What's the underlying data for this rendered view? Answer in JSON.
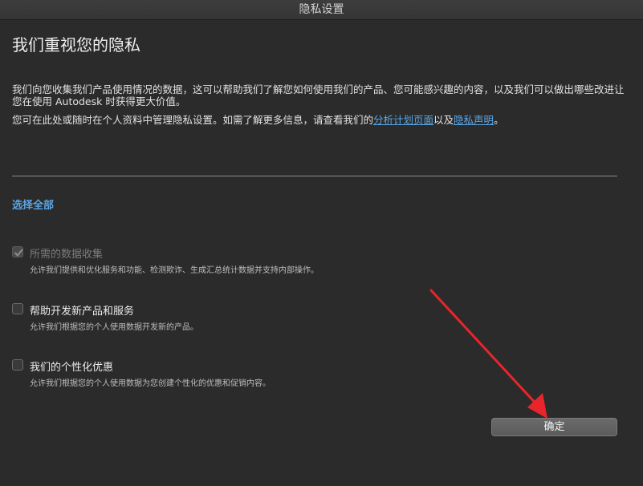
{
  "window": {
    "title": "隐私设置"
  },
  "page": {
    "title": "我们重视您的隐私"
  },
  "intro": {
    "paragraph1": "我们向您收集我们产品使用情况的数据，这可以帮助我们了解您如何使用我们的产品、您可能感兴趣的内容，以及我们可以做出哪些改进让您在使用 Autodesk 时获得更大价值。",
    "p2_before": "您可在此处或随时在个人资料中管理隐私设置。如需了解更多信息，请查看我们的",
    "p2_link1": "分析计划页面",
    "p2_middle": "以及",
    "p2_link2": "隐私声明",
    "p2_after": "。"
  },
  "select_all": "选择全部",
  "options": [
    {
      "title": "所需的数据收集",
      "desc": "允许我们提供和优化服务和功能、检测欺诈、生成汇总统计数据并支持内部操作。",
      "checked": true,
      "disabled": true
    },
    {
      "title": "帮助开发新产品和服务",
      "desc": "允许我们根据您的个人使用数据开发新的产品。",
      "checked": false,
      "disabled": false
    },
    {
      "title": "我们的个性化优惠",
      "desc": "允许我们根据您的个人使用数据为您创建个性化的优惠和促销内容。",
      "checked": false,
      "disabled": false
    }
  ],
  "ok_button": "确定",
  "colors": {
    "link": "#5aa6e6",
    "background": "#2b2b2b",
    "arrow": "#e8252a"
  },
  "icons": {
    "checkmark": "checkmark-icon",
    "arrow": "red-arrow-annotation"
  }
}
